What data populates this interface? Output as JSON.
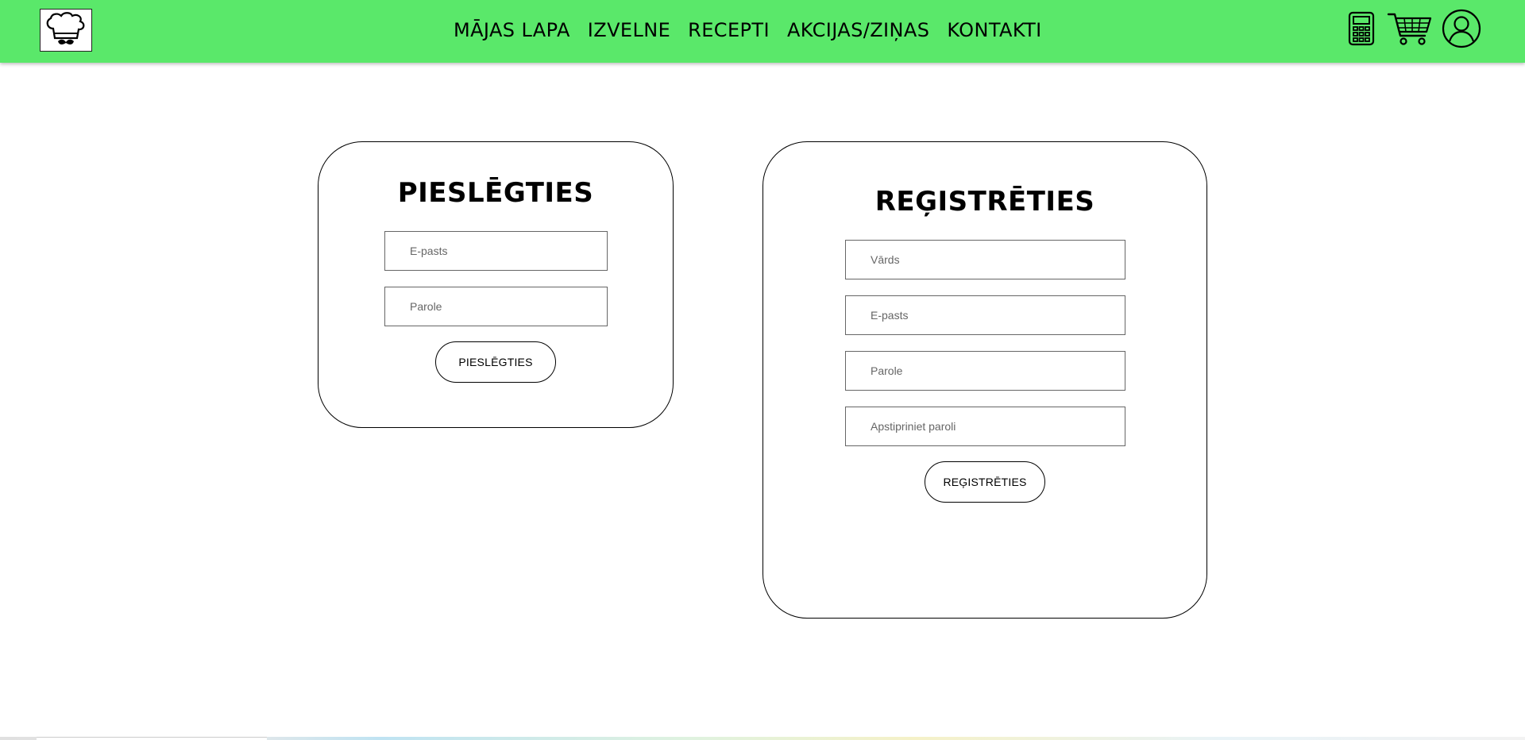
{
  "header": {
    "background_color": "#5ae86a",
    "logo_icon": "chef-hat-mustache-icon",
    "nav": [
      {
        "label": "MĀJAS LAPA"
      },
      {
        "label": "IZVELNE"
      },
      {
        "label": "RECEPTI"
      },
      {
        "label": "AKCIJAS/ZIŅAS"
      },
      {
        "label": "KONTAKTI"
      }
    ],
    "icons": [
      "calculator-icon",
      "shopping-cart-icon",
      "user-account-icon"
    ]
  },
  "login": {
    "title": "PIESLĒGTIES",
    "email_placeholder": "E-pasts",
    "password_placeholder": "Parole",
    "button_label": "PIESLĒGTIES"
  },
  "register": {
    "title": "REĢISTRĒTIES",
    "name_placeholder": "Vārds",
    "email_placeholder": "E-pasts",
    "password_placeholder": "Parole",
    "confirm_placeholder": "Apstipriniet paroli",
    "button_label": "REĢISTRĒTIES"
  }
}
